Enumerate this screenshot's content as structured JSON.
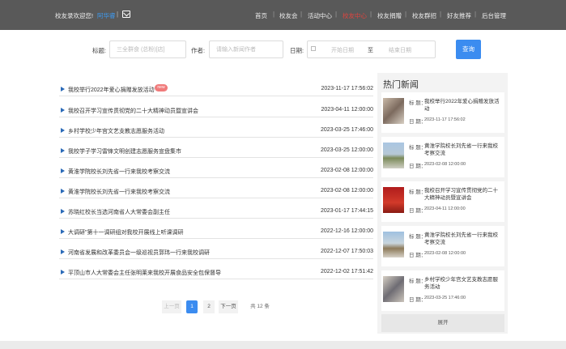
{
  "header": {
    "welcome": "校友录欢迎您!",
    "username": "阿华睿",
    "nav": [
      "首页",
      "校友会",
      "活动中心",
      "校友中心",
      "校友捐赠",
      "校友群招",
      "好友推荐",
      "后台管理"
    ],
    "active_nav": "校友中心"
  },
  "search": {
    "title_label": "标题:",
    "title_placeholder": "三全群食 (总粉)[店]",
    "author_label": "作者:",
    "author_placeholder": "请输入新闻作者",
    "date_label": "日期:",
    "start_placeholder": "开始日期",
    "to": "至",
    "end_placeholder": "结束日期",
    "query_label": "查询"
  },
  "news": [
    {
      "title": "我校举行2022年爱心捐赠发放活动",
      "date": "2023-11-17 17:56:02",
      "badge": "new"
    },
    {
      "title": "我校召开学习宣传贯彻党的二十大精神动员暨宣讲会",
      "date": "2023-04-11 12:00:00"
    },
    {
      "title": "乡村学校少年宫文艺支教志愿服务活动",
      "date": "2023-03-25 17:46:00"
    },
    {
      "title": "我校学子学习雷锋文明创建志愿服务宣盘集市",
      "date": "2023-03-25 12:00:00"
    },
    {
      "title": "黄淮学院校长刘先省一行来我校考察交流",
      "date": "2023-02-08 12:00:00"
    },
    {
      "title": "黄淮学院校长刘先省一行来我校考察交流",
      "date": "2023-02-08 12:00:00"
    },
    {
      "title": "苏晓红校长当选河南省人大常委会副主任",
      "date": "2023-01-17 17:44:15"
    },
    {
      "title": "大调研\"第十一调研组对我校开展线上听课调研",
      "date": "2022-12-16 12:00:00"
    },
    {
      "title": "河南省发展和改革委员会一级巡视员郭玮一行来我校调研",
      "date": "2022-12-07 17:50:03"
    },
    {
      "title": "平顶山市人大常委会主任张明莱来我校开展食品安全包保督导",
      "date": "2022-12-02 17:51:42"
    }
  ],
  "pagination": {
    "prev": "上一页",
    "current": "1",
    "page2": "2",
    "next": "下一页",
    "total": "共 12 条"
  },
  "hot": {
    "title": "热门新闻",
    "title_key": "标  题：",
    "date_key": "日  期：",
    "items": [
      {
        "title": "我校举行2022年爱心捐赠发放活动",
        "date": "2023-11-17 17:56:02"
      },
      {
        "title": "黄淮学院校长刘先省一行来我校考察交流",
        "date": "2023-02-08 12:00:00"
      },
      {
        "title": "我校召开学习宣传贯彻党的二十大精神动员暨宣讲会",
        "date": "2023-04-11 12:00:00"
      },
      {
        "title": "黄淮学院校长刘先省一行来我校考察交流",
        "date": "2023-02-08 12:00:00"
      },
      {
        "title": "乡村学校少年宫文艺支教志愿服务活动",
        "date": "2023-03-25 17:46:00"
      }
    ],
    "expand": "展开"
  }
}
